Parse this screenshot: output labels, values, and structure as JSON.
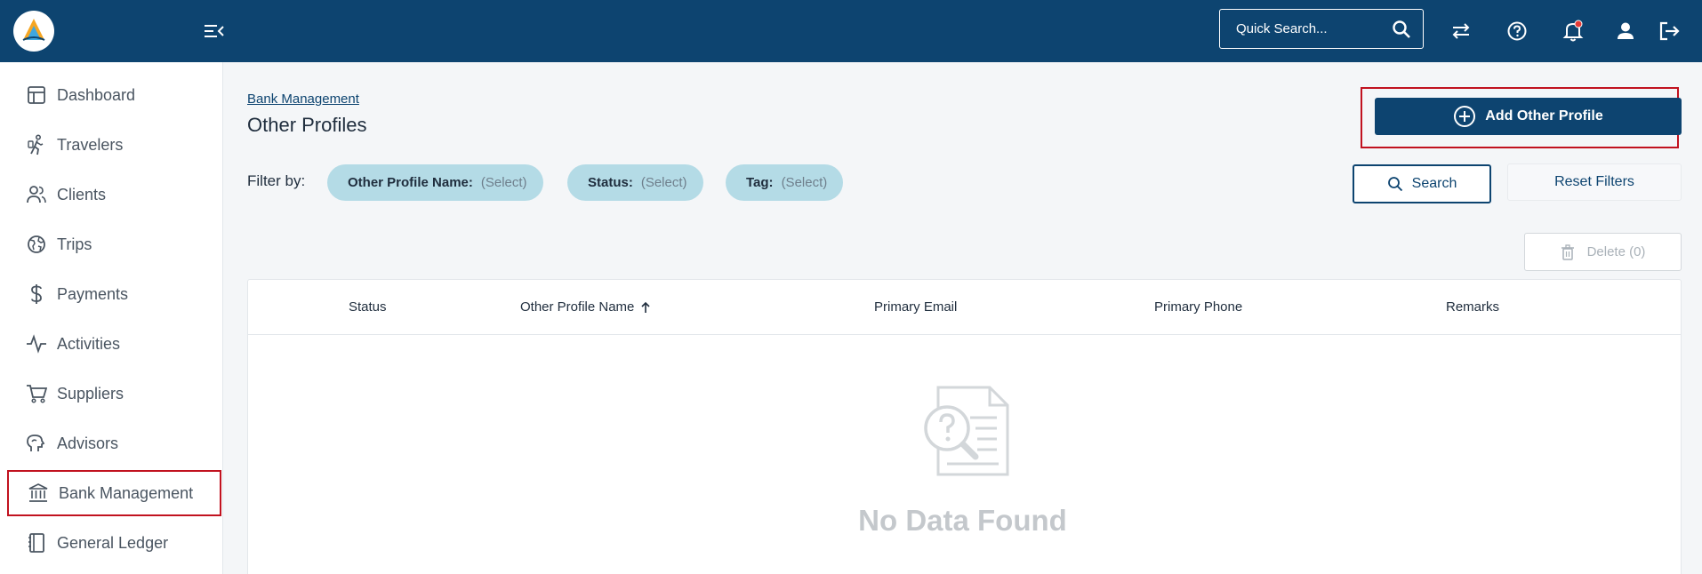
{
  "header": {
    "search_placeholder": "Quick Search...",
    "icons": [
      "logo",
      "menu-toggle-icon",
      "search-icon",
      "swap-icon",
      "help-icon",
      "bell-icon",
      "user-icon",
      "logout-icon"
    ],
    "notification_dot_color": "#e53935"
  },
  "sidebar": {
    "items": [
      {
        "label": "Dashboard",
        "icon": "dashboard-icon"
      },
      {
        "label": "Travelers",
        "icon": "traveler-icon"
      },
      {
        "label": "Clients",
        "icon": "clients-icon"
      },
      {
        "label": "Trips",
        "icon": "globe-icon"
      },
      {
        "label": "Payments",
        "icon": "dollar-icon"
      },
      {
        "label": "Activities",
        "icon": "activity-icon"
      },
      {
        "label": "Suppliers",
        "icon": "cart-icon"
      },
      {
        "label": "Advisors",
        "icon": "advisor-icon"
      },
      {
        "label": "Bank Management",
        "icon": "bank-icon",
        "active": true
      },
      {
        "label": "General Ledger",
        "icon": "ledger-icon"
      }
    ]
  },
  "main": {
    "breadcrumb": "Bank Management",
    "title": "Other Profiles",
    "add_button": "Add Other Profile",
    "filter_label": "Filter by:",
    "filters": [
      {
        "key": "Other Profile Name:",
        "value": "(Select)"
      },
      {
        "key": "Status:",
        "value": "(Select)"
      },
      {
        "key": "Tag:",
        "value": "(Select)"
      }
    ],
    "search_button": "Search",
    "reset_button": "Reset Filters",
    "delete_button": "Delete (0)",
    "table": {
      "columns": [
        "Status",
        "Other Profile Name",
        "Primary Email",
        "Primary Phone",
        "Remarks"
      ],
      "sorted_column": "Other Profile Name",
      "sort_direction": "ascending",
      "empty_text": "No Data Found"
    }
  },
  "colors": {
    "brand": "#0d4470",
    "highlight": "#c1121f",
    "chip": "#b4dbe6"
  }
}
